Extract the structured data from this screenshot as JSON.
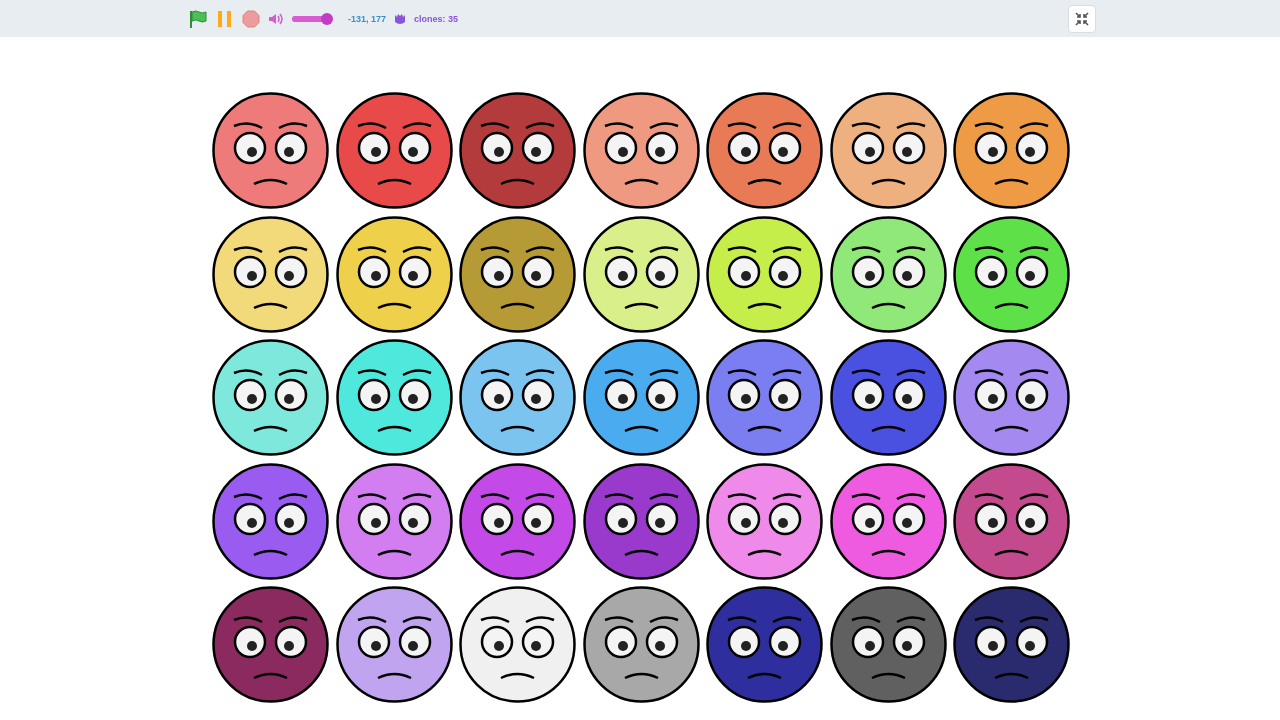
{
  "toolbar": {
    "volume": {
      "level": 0.95
    },
    "mouse_position": "-131, 177",
    "clones": "clones: 35"
  },
  "stage": {
    "faces": [
      {
        "color": "#ee7a7a"
      },
      {
        "color": "#e84a4a"
      },
      {
        "color": "#b33b3b"
      },
      {
        "color": "#ef9a80"
      },
      {
        "color": "#e87b55"
      },
      {
        "color": "#efb07f"
      },
      {
        "color": "#ef9a45"
      },
      {
        "color": "#f2d979"
      },
      {
        "color": "#efd04a"
      },
      {
        "color": "#b59a36"
      },
      {
        "color": "#d9f08a"
      },
      {
        "color": "#c5ee4a"
      },
      {
        "color": "#8fe878"
      },
      {
        "color": "#5ee048"
      },
      {
        "color": "#7fe8dc"
      },
      {
        "color": "#4fe8dc"
      },
      {
        "color": "#7cc4f0"
      },
      {
        "color": "#4aabee"
      },
      {
        "color": "#7b7ef0"
      },
      {
        "color": "#4a50e0"
      },
      {
        "color": "#a48af0"
      },
      {
        "color": "#9a5cf0"
      },
      {
        "color": "#d27ef0"
      },
      {
        "color": "#c44ae8"
      },
      {
        "color": "#9a3acc"
      },
      {
        "color": "#ef8aea"
      },
      {
        "color": "#ee5ae0"
      },
      {
        "color": "#c44a8e"
      },
      {
        "color": "#8a2a5e"
      },
      {
        "color": "#c0a4f0"
      },
      {
        "color": "#f0f0f0"
      },
      {
        "color": "#a8a8a8"
      },
      {
        "color": "#2e2e9e"
      },
      {
        "color": "#606060"
      },
      {
        "color": "#2a2a6e"
      }
    ]
  }
}
